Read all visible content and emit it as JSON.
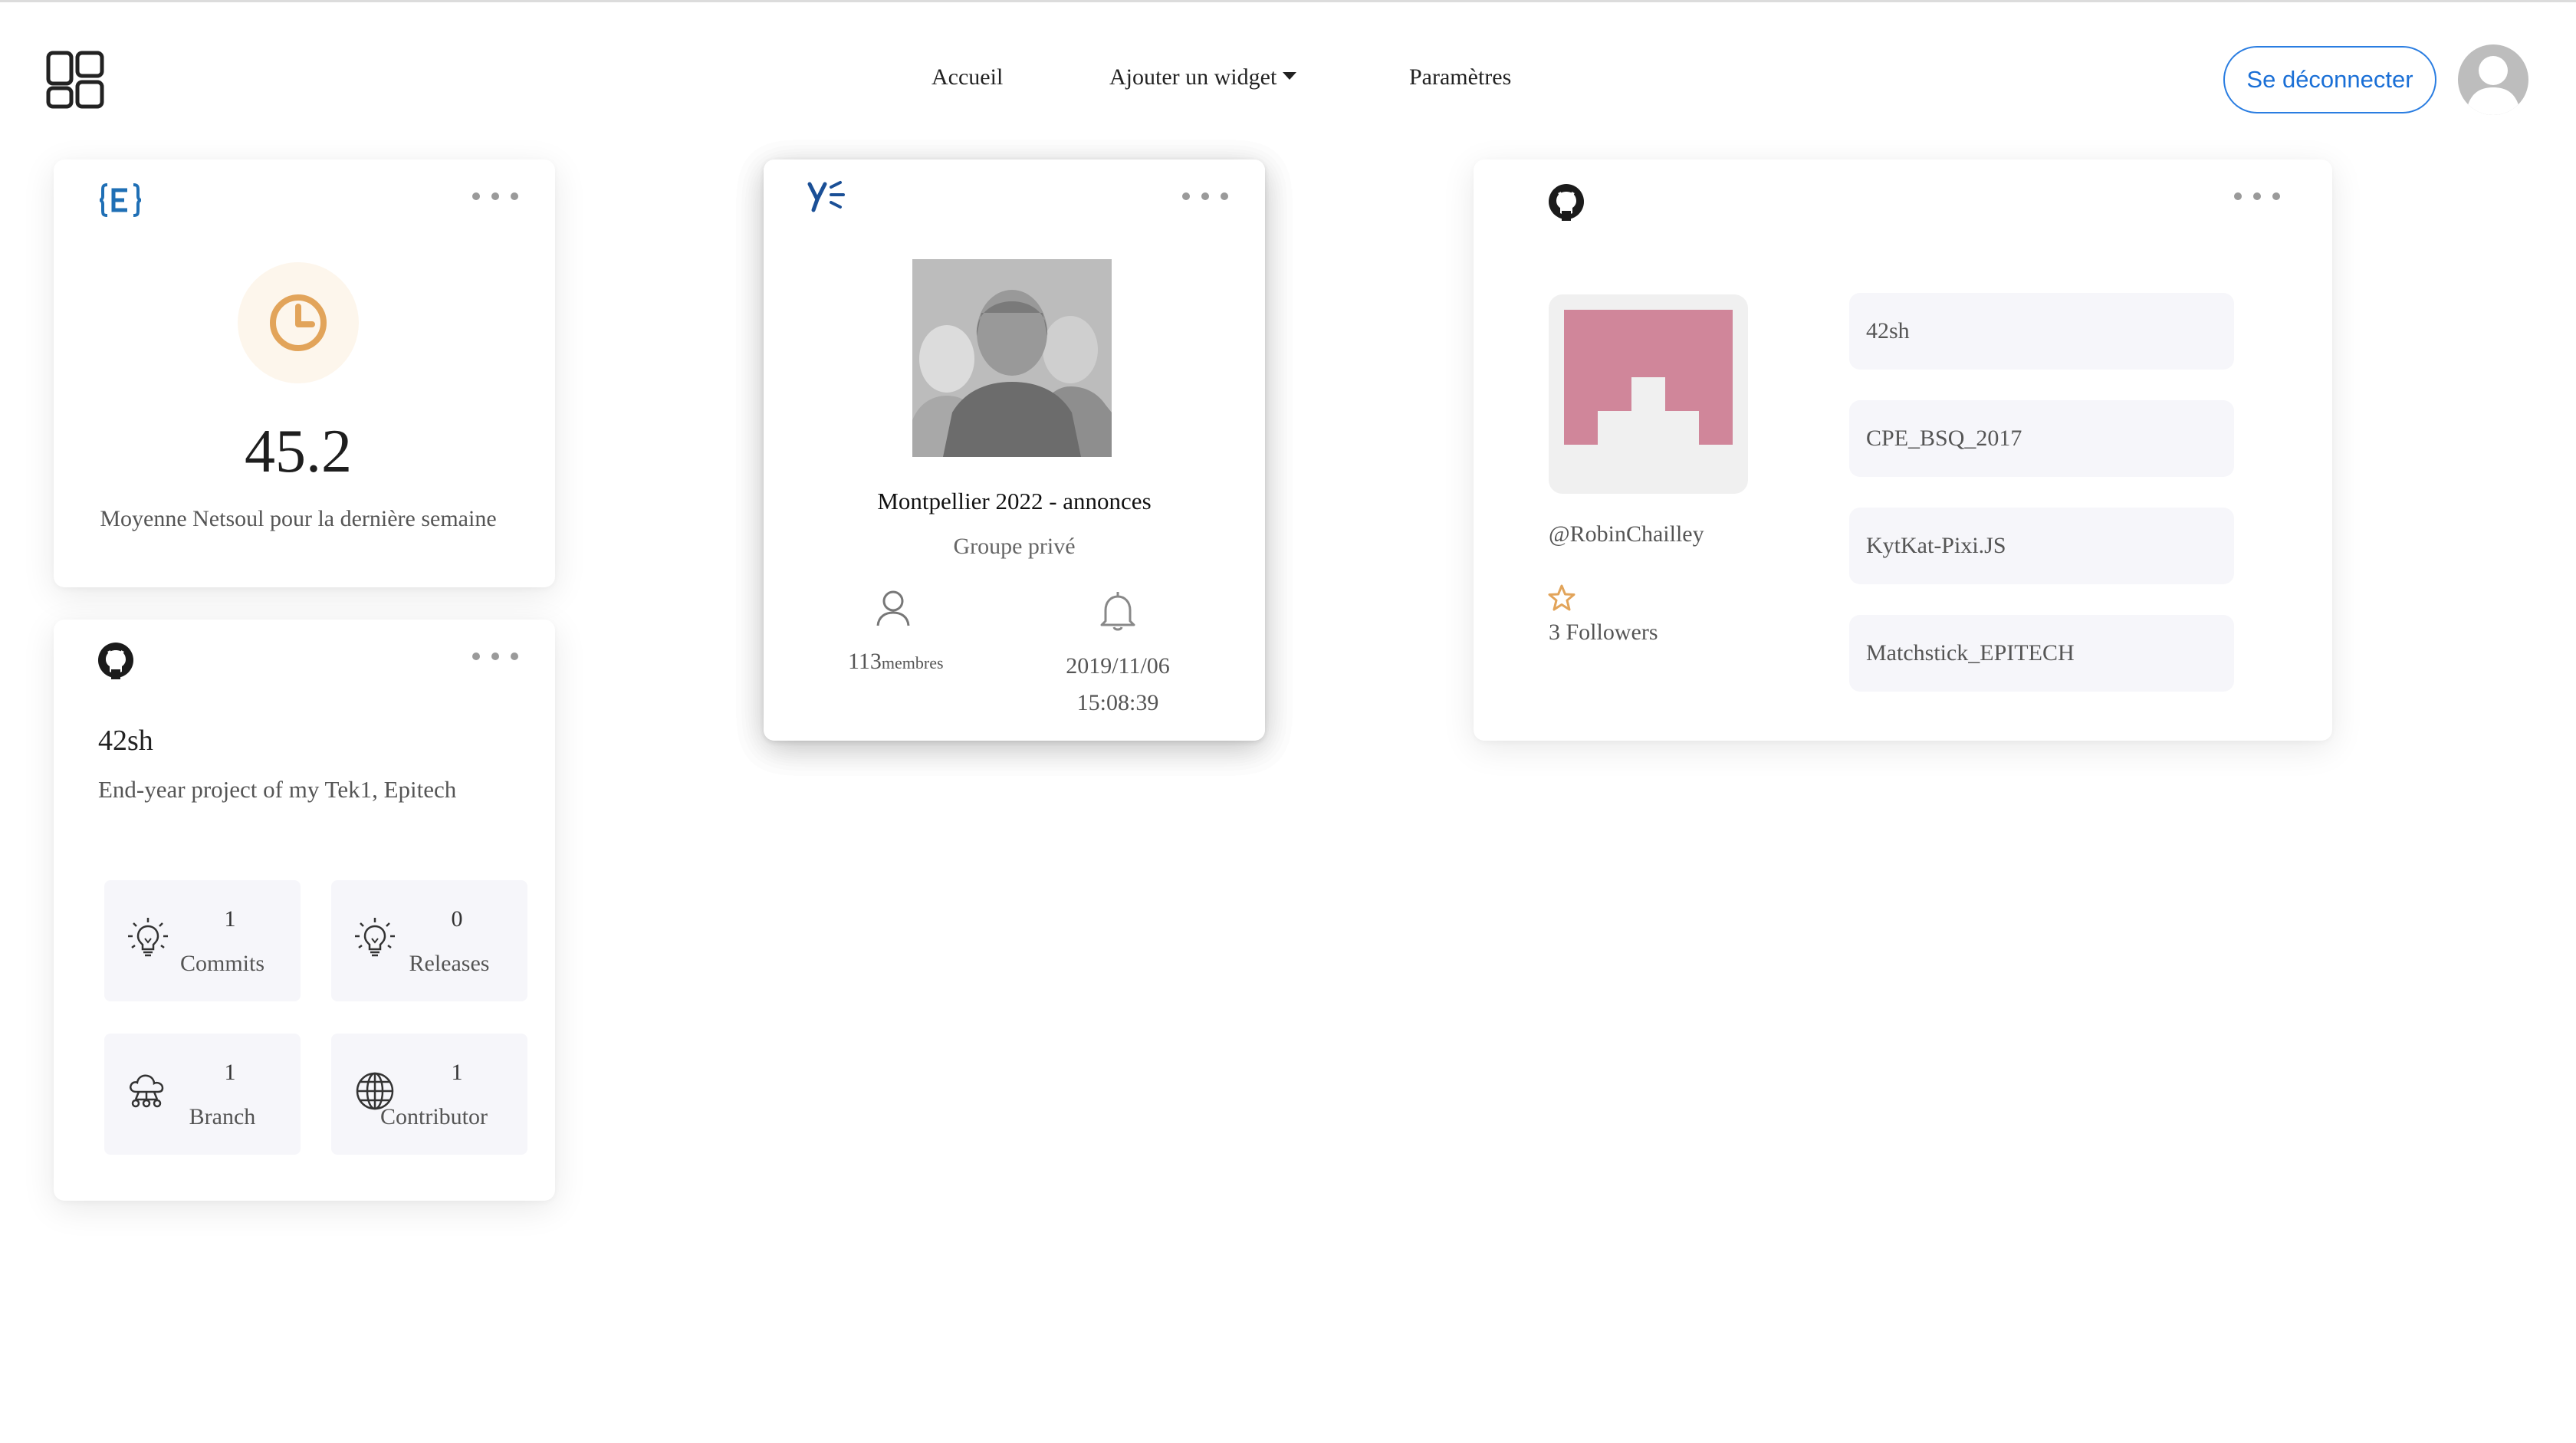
{
  "nav": {
    "home": "Accueil",
    "add_widget": "Ajouter un widget",
    "settings": "Paramètres",
    "logout": "Se déconnecter"
  },
  "netsoul_widget": {
    "value": "45.2",
    "label": "Moyenne Netsoul pour la dernière semaine",
    "accent_color": "#e2a45a"
  },
  "yammer_widget": {
    "group_name": "Montpellier 2022 - annonces",
    "group_type": "Groupe privé",
    "members_count": "113",
    "members_label": "membres",
    "date": "2019/11/06",
    "time": "15:08:39"
  },
  "github_repo_widget": {
    "repo_name": "42sh",
    "description": "End-year project of my Tek1, Epitech",
    "stats": [
      {
        "value": "1",
        "label": "Commits",
        "icon": "lightbulb-icon"
      },
      {
        "value": "0",
        "label": "Releases",
        "icon": "lightbulb-icon"
      },
      {
        "value": "1",
        "label": "Branch",
        "icon": "cloud-network-icon"
      },
      {
        "value": "1",
        "label": "Contributor",
        "icon": "globe-icon"
      }
    ]
  },
  "github_user_widget": {
    "username": "@RobinChailley",
    "followers": "3 Followers",
    "avatar_color": "#d0869a",
    "repos": [
      "42sh",
      "CPE_BSQ_2017",
      "KytKat-Pixi.JS",
      "Matchstick_EPITECH"
    ]
  }
}
